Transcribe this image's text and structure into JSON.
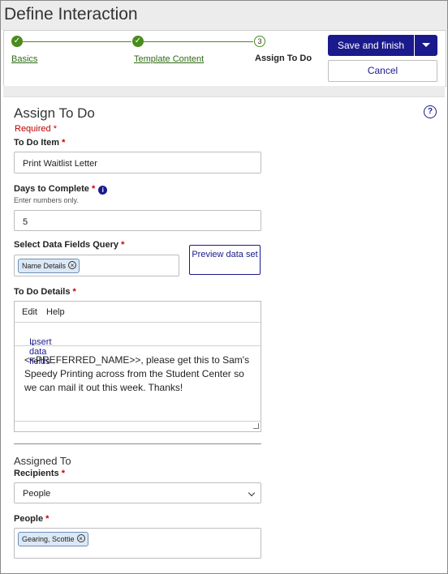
{
  "window": {
    "title": "Define Interaction"
  },
  "steps": [
    {
      "label": "Basics",
      "status": "done"
    },
    {
      "label": "Template Content",
      "status": "done"
    },
    {
      "number": "3",
      "label": "Assign To Do",
      "status": "current"
    }
  ],
  "actions": {
    "save_label": "Save and finish",
    "cancel_label": "Cancel"
  },
  "section": {
    "title": "Assign To Do",
    "required_note": "Required",
    "help": "?"
  },
  "fields": {
    "todo_item": {
      "label": "To Do Item",
      "value": "Print Waitlist Letter"
    },
    "days": {
      "label": "Days to Complete",
      "hint": "Enter numbers only.",
      "value": "5"
    },
    "query": {
      "label": "Select Data Fields Query",
      "chip": "Name Details",
      "preview_label": "Preview data set"
    },
    "details": {
      "label": "To Do Details",
      "menu": [
        "Edit",
        "Help"
      ],
      "insert_label": "Insert data fields",
      "text": "<<PREFERRED_NAME>>, please get this to Sam's Speedy Printing across from the Student Center so we can mail it out this week. Thanks!"
    }
  },
  "assigned": {
    "title": "Assigned To",
    "recipients": {
      "label": "Recipients",
      "value": "People"
    },
    "people": {
      "label": "People",
      "chip": "Gearing, Scottie"
    }
  },
  "colors": {
    "primary": "#1a1a8c",
    "step_green": "#4b8b1e",
    "required": "#cc0000"
  },
  "required_mark": "*"
}
